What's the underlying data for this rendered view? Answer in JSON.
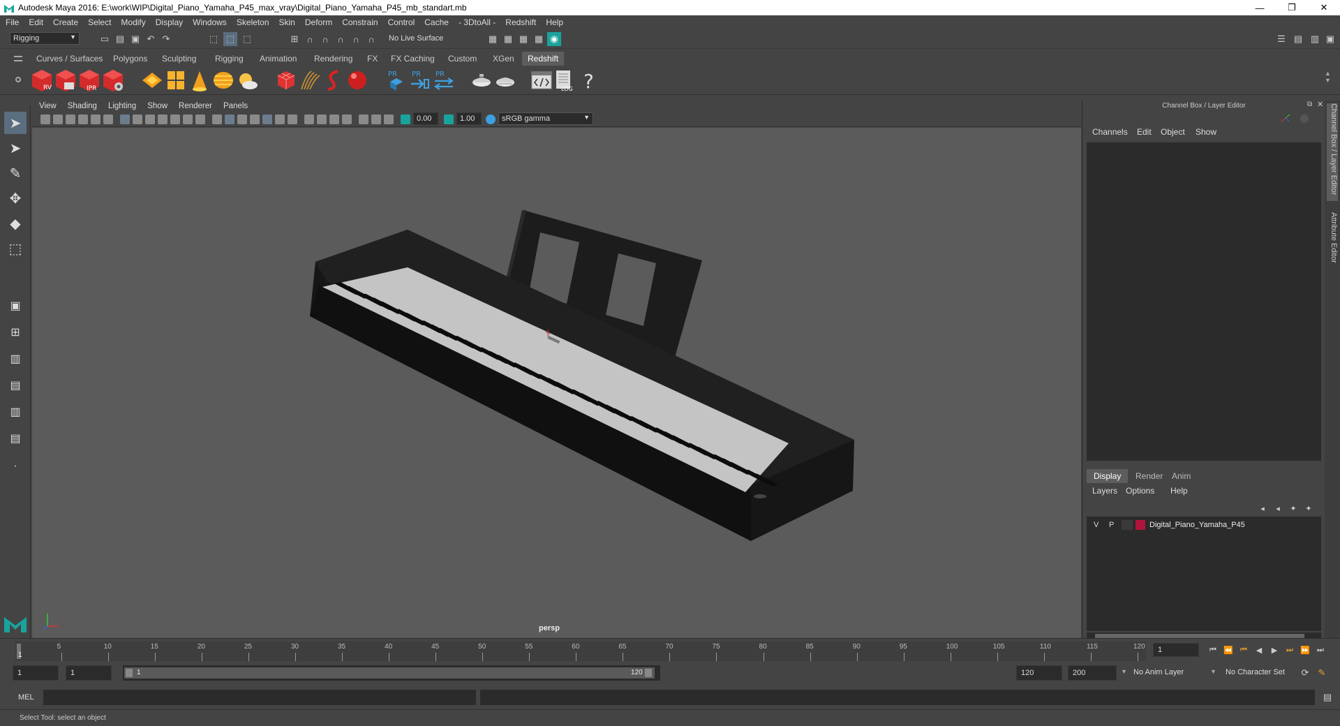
{
  "window": {
    "title": "Autodesk Maya 2016: E:\\work\\WIP\\Digital_Piano_Yamaha_P45_max_vray\\Digital_Piano_Yamaha_P45_mb_standart.mb",
    "minimize": "—",
    "maximize": "❐",
    "close": "✕"
  },
  "menubar": [
    "File",
    "Edit",
    "Create",
    "Select",
    "Modify",
    "Display",
    "Windows",
    "Skeleton",
    "Skin",
    "Deform",
    "Constrain",
    "Control",
    "Cache",
    "- 3DtoAll -",
    "Redshift",
    "Help"
  ],
  "statusline": {
    "menuset": "Rigging",
    "live_surface": "No Live Surface"
  },
  "shelf": {
    "tabs": [
      "Curves / Surfaces",
      "Polygons",
      "Sculpting",
      "Rigging",
      "Animation",
      "Rendering",
      "FX",
      "FX Caching",
      "Custom",
      "XGen",
      "Redshift"
    ],
    "active_tab": "Redshift",
    "icon_labels": {
      "rv": "RV",
      "ipr": "IPR",
      "pr1": "PR",
      "pr2": "PR",
      "pr3": "PR",
      "log": "LOG",
      "help": "?"
    }
  },
  "viewport": {
    "menu": [
      "View",
      "Shading",
      "Lighting",
      "Show",
      "Renderer",
      "Panels"
    ],
    "exposure": "0.00",
    "gamma": "1.00",
    "colorspace": "sRGB gamma",
    "camera_label": "persp"
  },
  "channelbox": {
    "title": "Channel Box / Layer Editor",
    "menu": [
      "Channels",
      "Edit",
      "Object",
      "Show"
    ]
  },
  "layer_editor": {
    "tabs": [
      "Display",
      "Render",
      "Anim"
    ],
    "active_tab": "Display",
    "menu": [
      "Layers",
      "Options",
      "Help"
    ],
    "layers": [
      {
        "v": "V",
        "p": "P",
        "color": "#b0143c",
        "name": "Digital_Piano_Yamaha_P45"
      }
    ]
  },
  "side_tabs": [
    "Channel Box / Layer Editor",
    "Attribute Editor"
  ],
  "timeline": {
    "ticks": [
      5,
      10,
      15,
      20,
      25,
      30,
      35,
      40,
      45,
      50,
      55,
      60,
      65,
      70,
      75,
      80,
      85,
      90,
      95,
      100,
      105,
      110,
      115,
      120
    ],
    "start_label": "1",
    "current_frame": "1"
  },
  "range": {
    "start": "1",
    "anim_start": "1",
    "range_start": "1",
    "range_end": "120",
    "end": "120",
    "anim_end": "200",
    "anim_layer": "No Anim Layer",
    "character_set": "No Character Set"
  },
  "command": {
    "label": "MEL"
  },
  "help_line": "Select Tool: select an object"
}
